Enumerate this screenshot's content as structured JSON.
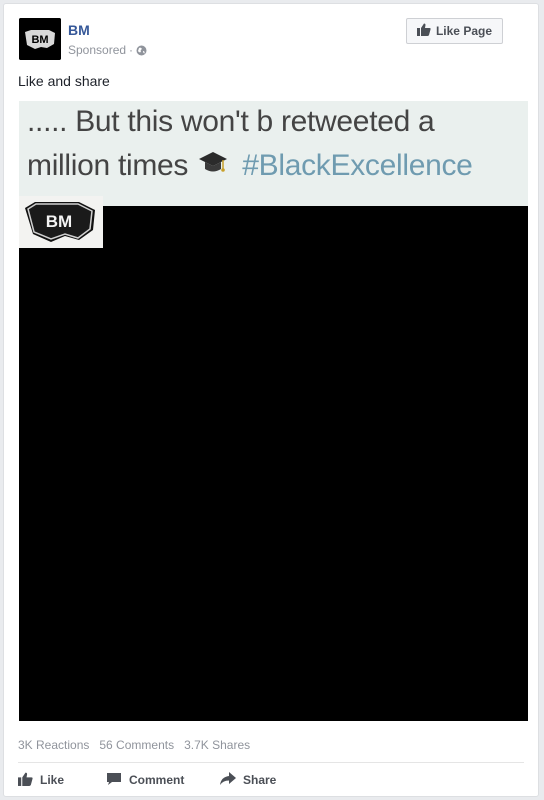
{
  "post": {
    "page_name": "BM",
    "sponsored_label": "Sponsored",
    "sponsored_separator": "·",
    "like_page_label": "Like Page",
    "text": "Like and share",
    "avatar_text": "BM"
  },
  "media": {
    "caption_line1": "..... But this won't b retweeted a",
    "caption_line2_text": "million times",
    "caption_hashtag": "#BlackExcellence",
    "watermark_text": "BM"
  },
  "stats": {
    "reactions": "3K Reactions",
    "comments": "56 Comments",
    "shares": "3.7K Shares"
  },
  "actions": {
    "like": "Like",
    "comment": "Comment",
    "share": "Share"
  },
  "colors": {
    "link_blue": "#365899",
    "meta_gray": "#90949c",
    "hashtag_blue": "#6f9bb0",
    "action_gray": "#4b4f56"
  },
  "icons": {
    "like": "thumbs-up-icon",
    "comment": "speech-bubble-icon",
    "share": "share-arrow-icon",
    "privacy": "globe-icon",
    "caption": "graduation-cap-icon"
  }
}
